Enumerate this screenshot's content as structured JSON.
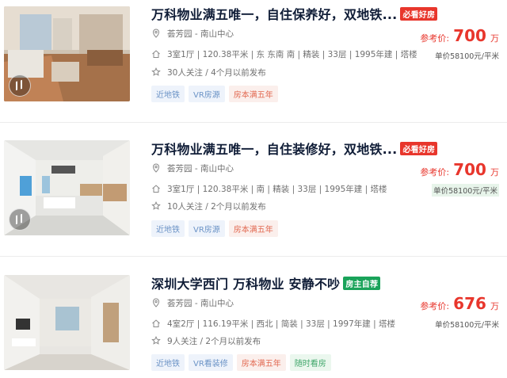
{
  "listings": [
    {
      "title": "万科物业满五唯一，自住保养好，双地铁...",
      "badge": "必看好房",
      "location": "荟芳园 - 南山中心",
      "specs": "3室1厅 | 120.38平米 | 东 东南 南 | 精装 | 33层 | 1995年建 | 塔楼",
      "follow": "30人关注 / 4个月以前发布",
      "tags": [
        "近地铁",
        "VR房源",
        "房本满五年"
      ],
      "price_label": "参考价:",
      "price": "700",
      "price_unit": "万",
      "unit_price": "单价58100元/平米"
    },
    {
      "title": "万科物业满五唯一，自住装修好，双地铁...",
      "badge": "必看好房",
      "location": "荟芳园 - 南山中心",
      "specs": "3室1厅 | 120.38平米 | 南 | 精装 | 33层 | 1995年建 | 塔楼",
      "follow": "10人关注 / 2个月以前发布",
      "tags": [
        "近地铁",
        "VR房源",
        "房本满五年"
      ],
      "price_label": "参考价:",
      "price": "700",
      "price_unit": "万",
      "unit_price": "单价58100元/平米"
    },
    {
      "title": "深圳大学西门 万科物业 安静不吵",
      "badge": "房主自荐",
      "location": "荟芳园 - 南山中心",
      "specs": "4室2厅 | 116.19平米 | 西北 | 简装 | 33层 | 1997年建 | 塔楼",
      "follow": "9人关注 / 2个月以前发布",
      "tags": [
        "近地铁",
        "VR看装修",
        "房本满五年",
        "随时看房"
      ],
      "price_label": "参考价:",
      "price": "676",
      "price_unit": "万",
      "unit_price": "单价58100元/平米"
    }
  ],
  "icons": {
    "location": "location-pin-icon",
    "house": "house-icon",
    "star": "star-icon",
    "vr": "vr-icon"
  },
  "colors": {
    "accent_red": "#e8362c",
    "accent_green": "#1aa35a",
    "title": "#101d37"
  }
}
